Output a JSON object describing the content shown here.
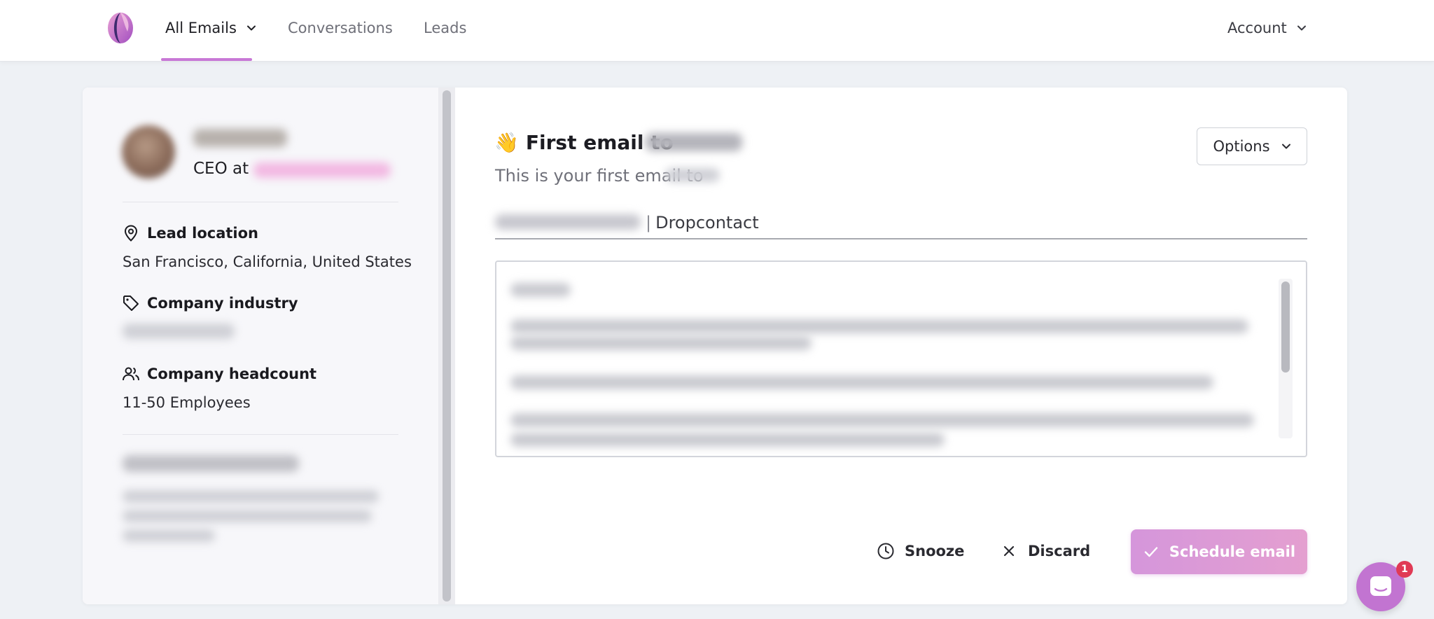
{
  "nav": {
    "all_emails": "All Emails",
    "conversations": "Conversations",
    "leads": "Leads",
    "account": "Account"
  },
  "lead": {
    "role_prefix": "CEO at",
    "location_title": "Lead location",
    "location_value": "San Francisco, California, United States",
    "industry_title": "Company industry",
    "headcount_title": "Company headcount",
    "headcount_value": "11-50 Employees"
  },
  "email": {
    "title_emoji": "👋",
    "title_prefix": "First email to",
    "subtitle_prefix": "This is your first email to",
    "options_label": "Options",
    "subject_separator": "|",
    "subject_visible": "Dropcontact"
  },
  "actions": {
    "snooze": "Snooze",
    "discard": "Discard",
    "schedule": "Schedule email"
  },
  "chat": {
    "badge_count": "1"
  },
  "colors": {
    "accent": "#c878d6",
    "schedule_gradient_start": "#d596db",
    "schedule_gradient_end": "#e49fd0",
    "badge": "#e03a55"
  }
}
